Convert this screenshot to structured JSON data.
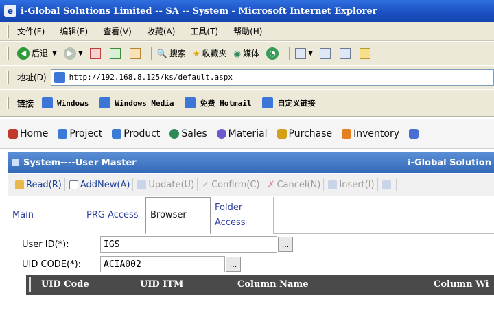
{
  "window": {
    "title": "i-Global Solutions Limited -- SA -- System - Microsoft Internet Explorer",
    "app_icon": "ie-icon"
  },
  "menubar": {
    "items": [
      "文件(F)",
      "编辑(E)",
      "查看(V)",
      "收藏(A)",
      "工具(T)",
      "帮助(H)"
    ]
  },
  "toolbar": {
    "back_label": "后退",
    "search_label": "搜索",
    "favorites_label": "收藏夹",
    "media_label": "媒体"
  },
  "addressbar": {
    "label": "地址(D)",
    "url": "http://192.168.8.125/ks/default.aspx"
  },
  "linksbar": {
    "label": "链接",
    "items": [
      "Windows",
      "Windows Media",
      "免费 Hotmail",
      "自定义链接"
    ]
  },
  "appnav": {
    "items": [
      "Home",
      "Project",
      "Product",
      "Sales",
      "Material",
      "Purchase",
      "Inventory"
    ],
    "colors": [
      "#c0392b",
      "#3a7bd5",
      "#3a7bd5",
      "#2e8b57",
      "#6a5acd",
      "#d4a017",
      "#e67e22"
    ]
  },
  "panel": {
    "title": "System----User Master",
    "brand": "i-Global Solution"
  },
  "actions": {
    "read": "Read(R)",
    "addnew": "AddNew(A)",
    "update": "Update(U)",
    "confirm": "Confirm(C)",
    "cancel": "Cancel(N)",
    "insert": "Insert(I)"
  },
  "tabs": {
    "main": "Main",
    "prg_access": "PRG Access",
    "browser": "Browser",
    "folder_access": "Folder Access"
  },
  "form": {
    "user_id_label": "User ID(*):",
    "user_id_value": "IGS",
    "uid_code_label": "UID CODE(*):",
    "uid_code_value": "ACIA002",
    "lookup_label": "..."
  },
  "grid": {
    "columns": [
      "UID Code",
      "UID ITM",
      "Column Name",
      "Column Wi"
    ]
  }
}
